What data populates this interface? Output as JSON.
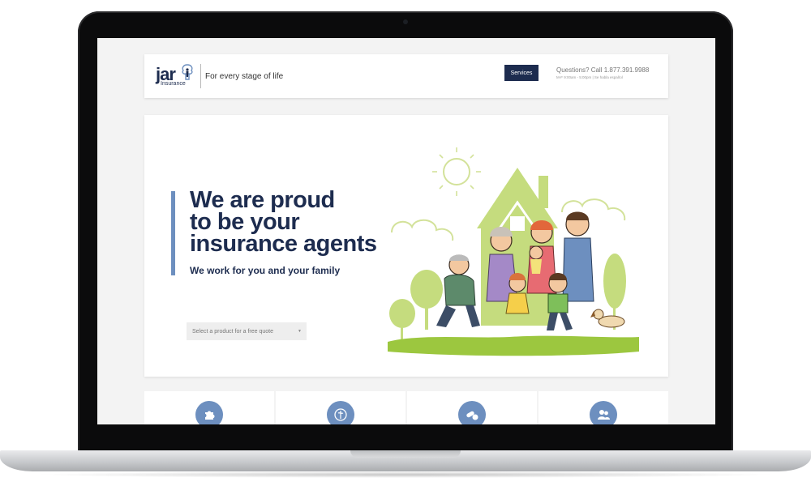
{
  "header": {
    "logo_word": "jar",
    "logo_sub": "Insurance",
    "tagline": "For every stage of life",
    "services_label": "Services",
    "phone_text": "Questions? Call 1.877.391.9988",
    "hours_text": "M-F 9:00am - 5:00pm | Se habla español"
  },
  "hero": {
    "headline": [
      "We are proud",
      "to be your",
      "insurance agents"
    ],
    "subhead": "We work for you and your family",
    "quote_placeholder": "Select a product for a free quote"
  },
  "features": [
    {
      "icon": "puzzle-icon"
    },
    {
      "icon": "medical-seal-icon"
    },
    {
      "icon": "pills-icon"
    },
    {
      "icon": "people-icon"
    }
  ],
  "colors": {
    "navy": "#1d2c4f",
    "accent_blue": "#6d8fbf",
    "illustration_green": "#c5dc7e"
  }
}
